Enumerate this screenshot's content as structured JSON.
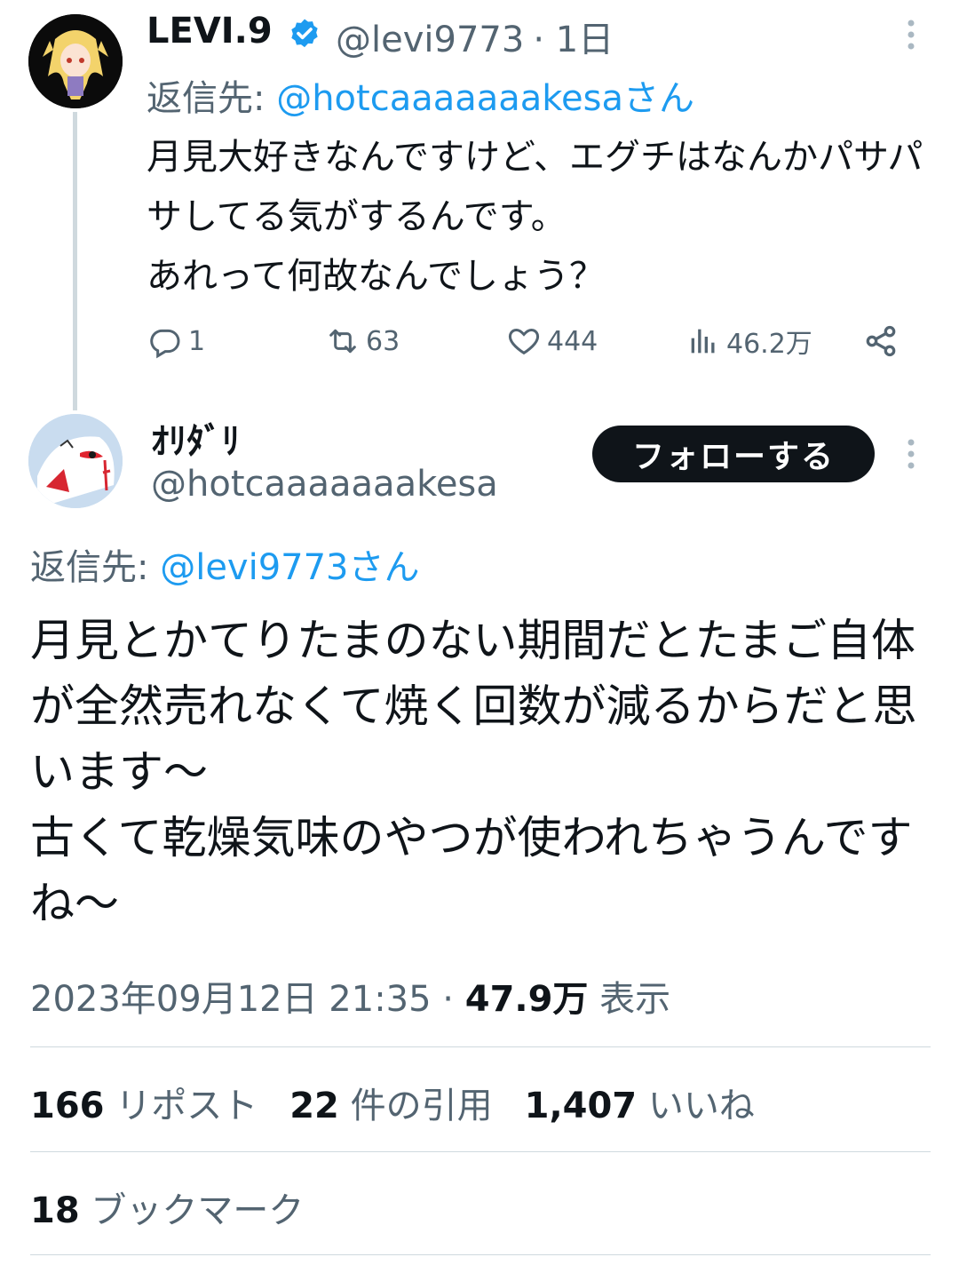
{
  "parent_tweet": {
    "display_name": "LEVI.9",
    "handle": "@levi9773",
    "time": "· 1日",
    "reply_to_prefix": "返信先: ",
    "reply_to_user": "@hotcaaaaaaakesaさん",
    "text": "月見大好きなんですけど、エグチはなんかパサパサしてる気がするんです。\nあれって何故なんでしょう？",
    "actions": {
      "reply_count": "1",
      "repost_count": "63",
      "like_count": "444",
      "view_count": "46.2万"
    }
  },
  "main_tweet": {
    "display_name": "ｵﾘﾀﾞﾘ",
    "handle": "@hotcaaaaaaakesa",
    "follow_label": "フォローする",
    "reply_to_prefix": "返信先: ",
    "reply_to_user": "@levi9773さん",
    "text": "月見とかてりたまのない期間だとたまご自体が全然売れなくて焼く回数が減るからだと思います〜\n古くて乾燥気味のやつが使われちゃうんですね〜",
    "timestamp": "2023年09月12日 21:35 · ",
    "views_count": "47.9万",
    "views_label": " 表示",
    "stats": {
      "reposts_count": "166",
      "reposts_label": " リポスト",
      "quotes_count": "22",
      "quotes_label": " 件の引用",
      "likes_count": "1,407",
      "likes_label": " いいね",
      "bookmarks_count": "18",
      "bookmarks_label": " ブックマーク"
    }
  },
  "colors": {
    "link": "#1d9bf0",
    "muted": "#536471",
    "text": "#0f1419",
    "verified": "#1d9bf0"
  }
}
